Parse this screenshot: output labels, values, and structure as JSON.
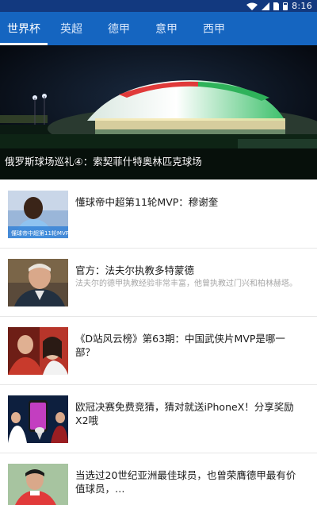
{
  "status_bar": {
    "time": "8:16",
    "icons": [
      "wifi-icon",
      "signal-icon",
      "sim-icon",
      "battery-icon"
    ]
  },
  "tabs": [
    {
      "label": "世界杯",
      "active": true
    },
    {
      "label": "英超",
      "active": false
    },
    {
      "label": "德甲",
      "active": false
    },
    {
      "label": "意甲",
      "active": false
    },
    {
      "label": "西甲",
      "active": false
    }
  ],
  "banner": {
    "caption": "俄罗斯球场巡礼④：索契菲什特奥林匹克球场",
    "pages": 1,
    "current_page": 1
  },
  "news": [
    {
      "title": "懂球帝中超第11轮MVP：穆谢奎",
      "summary": "",
      "thumb": "man-smiling-blue-jersey",
      "thumb_text": "懂球帝中超第11轮MVP"
    },
    {
      "title": "官方：法夫尔执教多特蒙德",
      "summary": "法夫尔的德甲执教经验非常丰富，他曾执教过门兴和柏林赫塔。",
      "thumb": "coach-portrait",
      "thumb_text": ""
    },
    {
      "title": "《D站风云榜》第63期：中国武侠片MVP是哪一部？",
      "summary": "",
      "thumb": "drinking-red-clothes",
      "thumb_text": ""
    },
    {
      "title": "欧冠决赛免费竞猜，猜对就送iPhoneX！分享奖励X2哦",
      "summary": "",
      "thumb": "iphone-trophy-promo",
      "thumb_text": ""
    },
    {
      "title": "当选过20世纪亚洲最佳球员，也曾荣膺德甲最有价值球员，…",
      "summary": "",
      "thumb": "player-red-jersey",
      "thumb_text": ""
    }
  ],
  "colors": {
    "status_bar": "#12397f",
    "tab_bar": "#1565c0",
    "tab_text": "#ffffff",
    "title_text": "#1a1a1a",
    "summary_text": "#a7a7a7",
    "indicator_dot": "#2f8ef0"
  }
}
